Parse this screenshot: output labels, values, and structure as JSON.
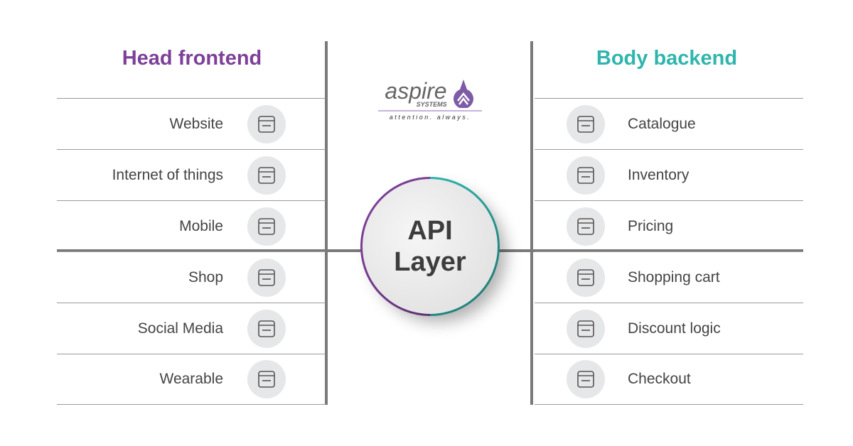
{
  "colors": {
    "purple": "#7d3f98",
    "teal": "#2fb5ad",
    "line": "#7a7a7a"
  },
  "left": {
    "title": "Head frontend",
    "items": [
      {
        "label": "Website",
        "icon": "monitor-www-icon"
      },
      {
        "label": "Internet of things",
        "icon": "smart-home-phone-icon"
      },
      {
        "label": "Mobile",
        "icon": "hand-phone-icon"
      },
      {
        "label": "Shop",
        "icon": "storefront-icon"
      },
      {
        "label": "Social Media",
        "icon": "social-media-icon"
      },
      {
        "label": "Wearable",
        "icon": "smartwatch-icon"
      }
    ]
  },
  "right": {
    "title": "Body backend",
    "items": [
      {
        "label": "Catalogue",
        "icon": "catalogue-icon"
      },
      {
        "label": "Inventory",
        "icon": "inventory-shelf-icon"
      },
      {
        "label": "Pricing",
        "icon": "price-tag-icon"
      },
      {
        "label": "Shopping cart",
        "icon": "cart-browser-icon"
      },
      {
        "label": "Discount logic",
        "icon": "discount-tag-icon"
      },
      {
        "label": "Checkout",
        "icon": "checkout-icon"
      }
    ]
  },
  "center": {
    "line1": "API",
    "line2": "Layer"
  },
  "logo": {
    "name": "aspire",
    "sub": "SYSTEMS",
    "tagline": "attention. always."
  }
}
